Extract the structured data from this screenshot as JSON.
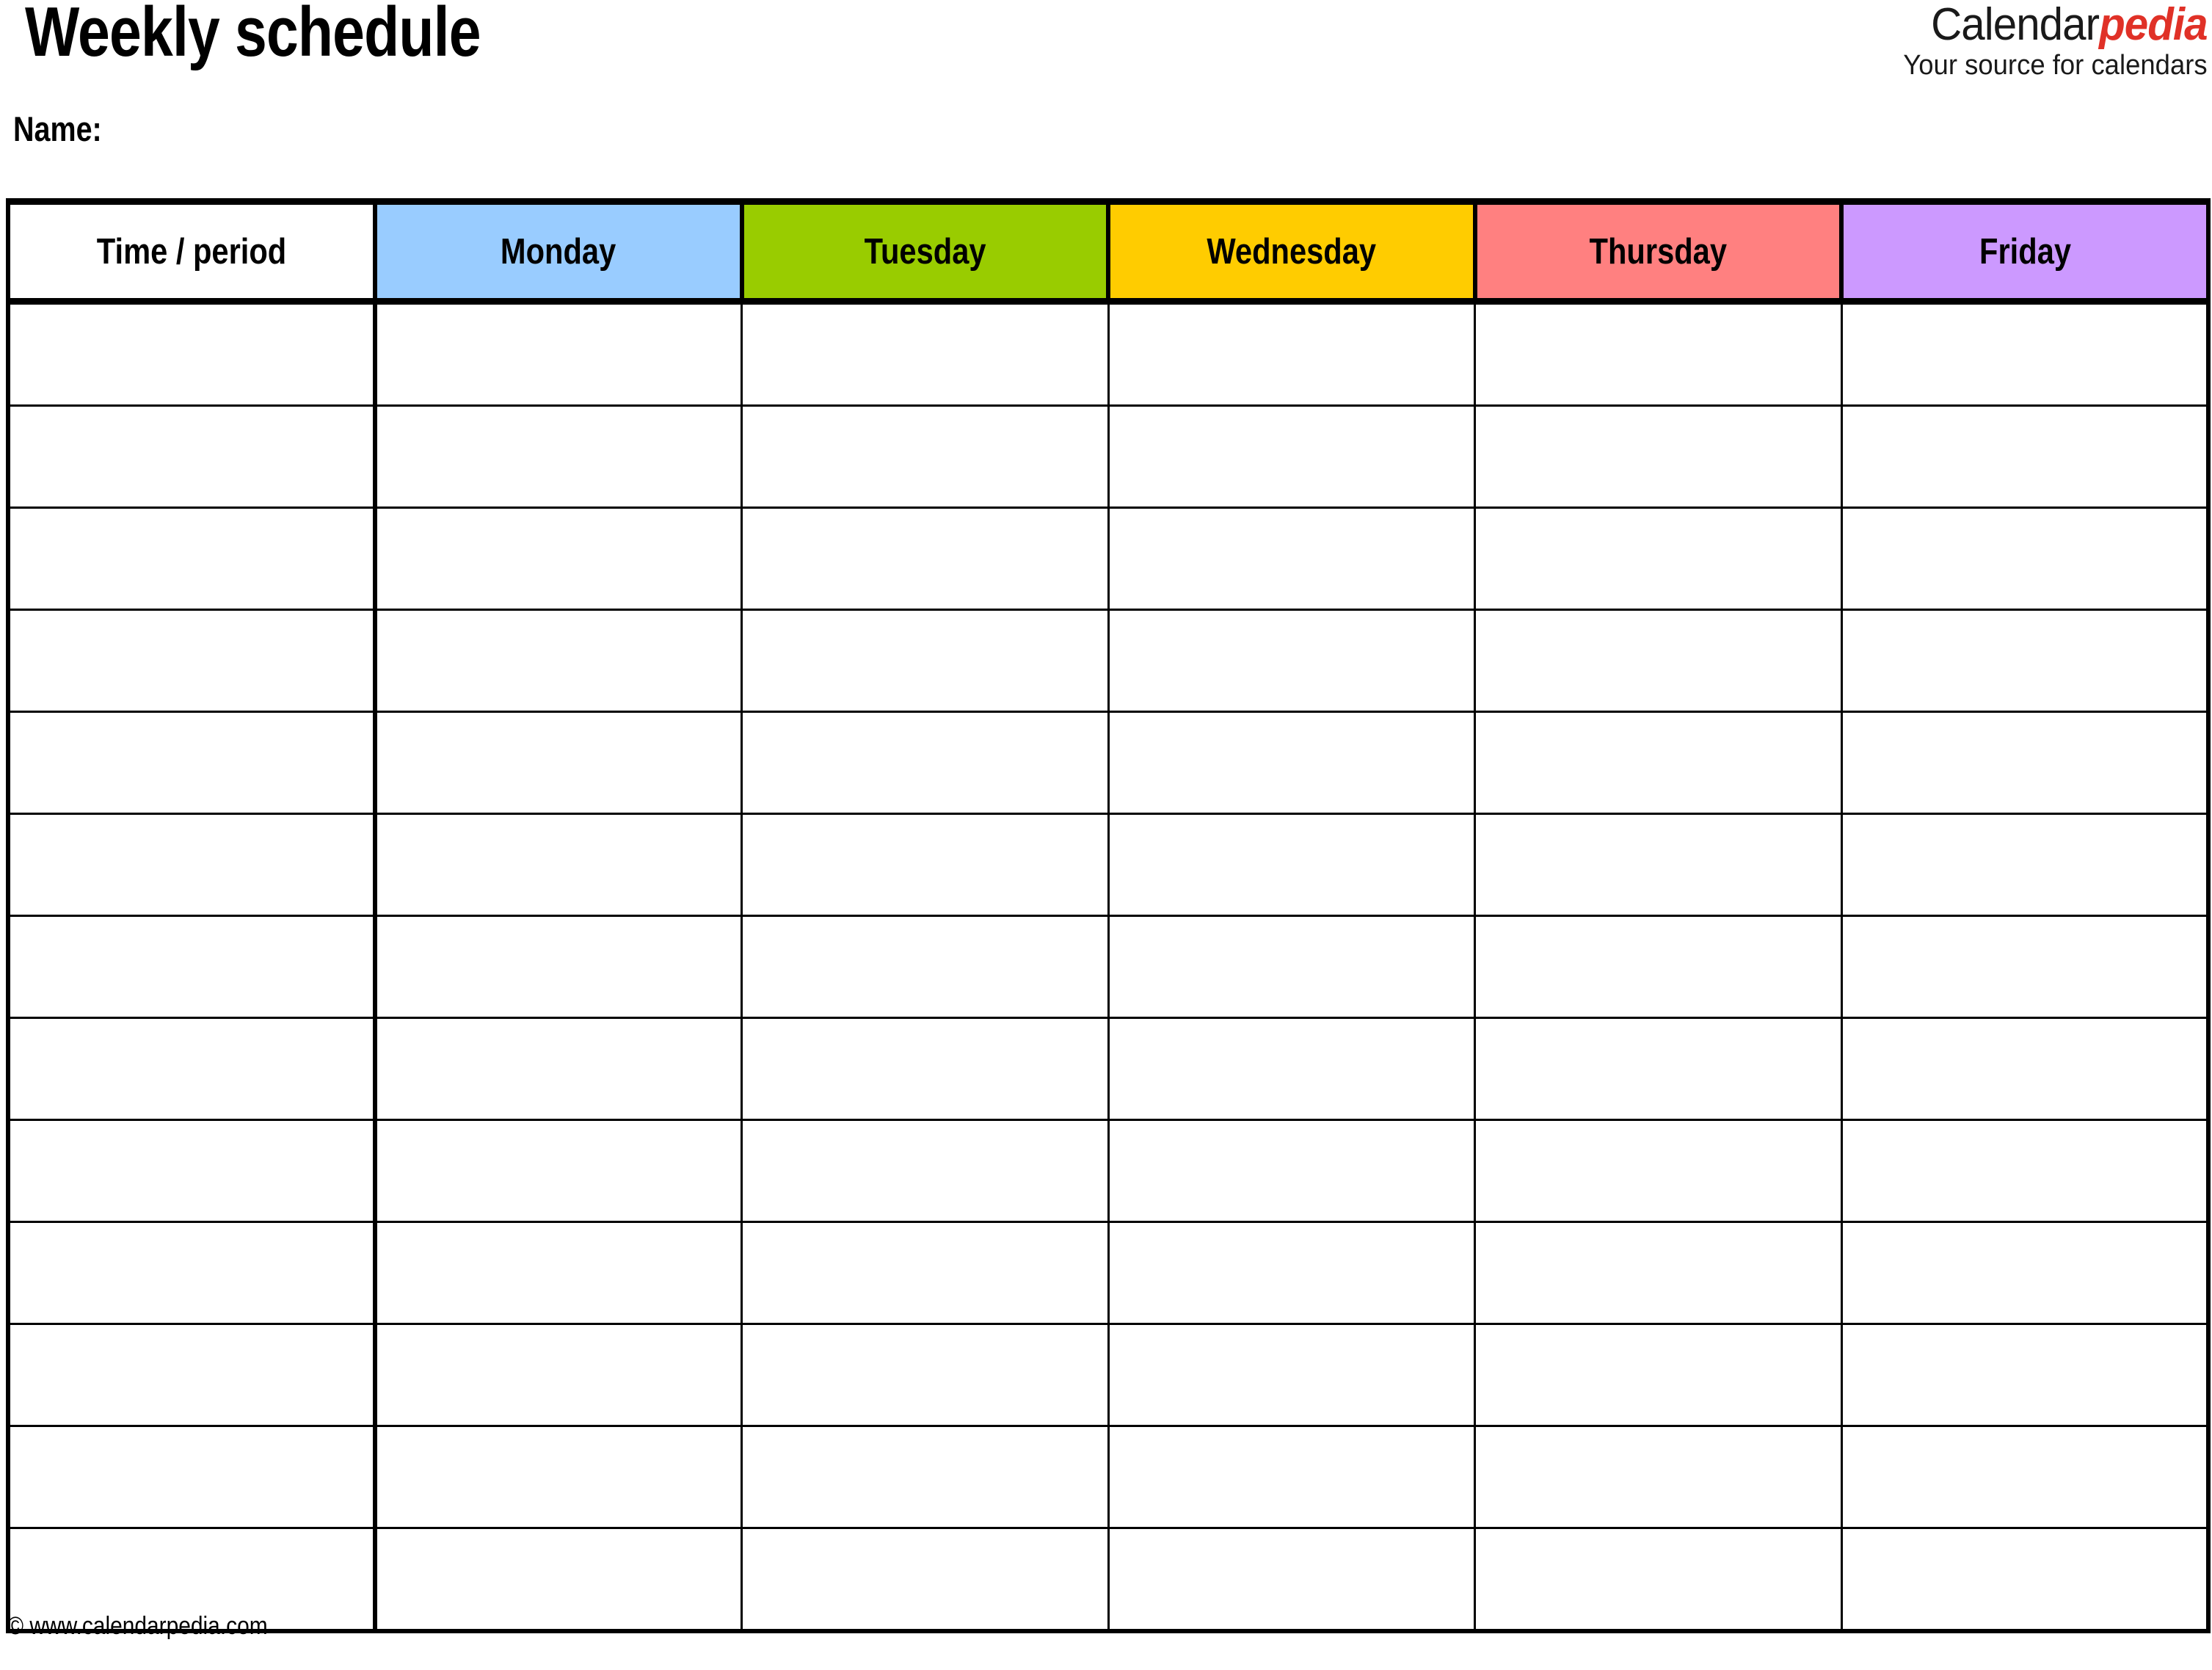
{
  "document": {
    "title": "Weekly schedule",
    "name_label": "Name:"
  },
  "logo": {
    "brand_part1": "Calendar",
    "brand_part2": "pedia",
    "tagline": "Your source for calendars",
    "brand_part2_color": "#E03127",
    "brand_part1_color": "#1a1a1a"
  },
  "table": {
    "columns": [
      {
        "label": "Time / period",
        "bg": "#FFFFFF",
        "key": "time"
      },
      {
        "label": "Monday",
        "bg": "#99CCFF",
        "key": "monday"
      },
      {
        "label": "Tuesday",
        "bg": "#99CC00",
        "key": "tuesday"
      },
      {
        "label": "Wednesday",
        "bg": "#FFCC00",
        "key": "wednesday"
      },
      {
        "label": "Thursday",
        "bg": "#FF8080",
        "key": "thursday"
      },
      {
        "label": "Friday",
        "bg": "#CC99FF",
        "key": "friday"
      }
    ],
    "row_count": 13,
    "rows": [
      {
        "time": "",
        "monday": "",
        "tuesday": "",
        "wednesday": "",
        "thursday": "",
        "friday": ""
      },
      {
        "time": "",
        "monday": "",
        "tuesday": "",
        "wednesday": "",
        "thursday": "",
        "friday": ""
      },
      {
        "time": "",
        "monday": "",
        "tuesday": "",
        "wednesday": "",
        "thursday": "",
        "friday": ""
      },
      {
        "time": "",
        "monday": "",
        "tuesday": "",
        "wednesday": "",
        "thursday": "",
        "friday": ""
      },
      {
        "time": "",
        "monday": "",
        "tuesday": "",
        "wednesday": "",
        "thursday": "",
        "friday": ""
      },
      {
        "time": "",
        "monday": "",
        "tuesday": "",
        "wednesday": "",
        "thursday": "",
        "friday": ""
      },
      {
        "time": "",
        "monday": "",
        "tuesday": "",
        "wednesday": "",
        "thursday": "",
        "friday": ""
      },
      {
        "time": "",
        "monday": "",
        "tuesday": "",
        "wednesday": "",
        "thursday": "",
        "friday": ""
      },
      {
        "time": "",
        "monday": "",
        "tuesday": "",
        "wednesday": "",
        "thursday": "",
        "friday": ""
      },
      {
        "time": "",
        "monday": "",
        "tuesday": "",
        "wednesday": "",
        "thursday": "",
        "friday": ""
      },
      {
        "time": "",
        "monday": "",
        "tuesday": "",
        "wednesday": "",
        "thursday": "",
        "friday": ""
      },
      {
        "time": "",
        "monday": "",
        "tuesday": "",
        "wednesday": "",
        "thursday": "",
        "friday": ""
      },
      {
        "time": "",
        "monday": "",
        "tuesday": "",
        "wednesday": "",
        "thursday": "",
        "friday": ""
      }
    ]
  },
  "footer": {
    "copyright": "© www.calendarpedia.com"
  }
}
